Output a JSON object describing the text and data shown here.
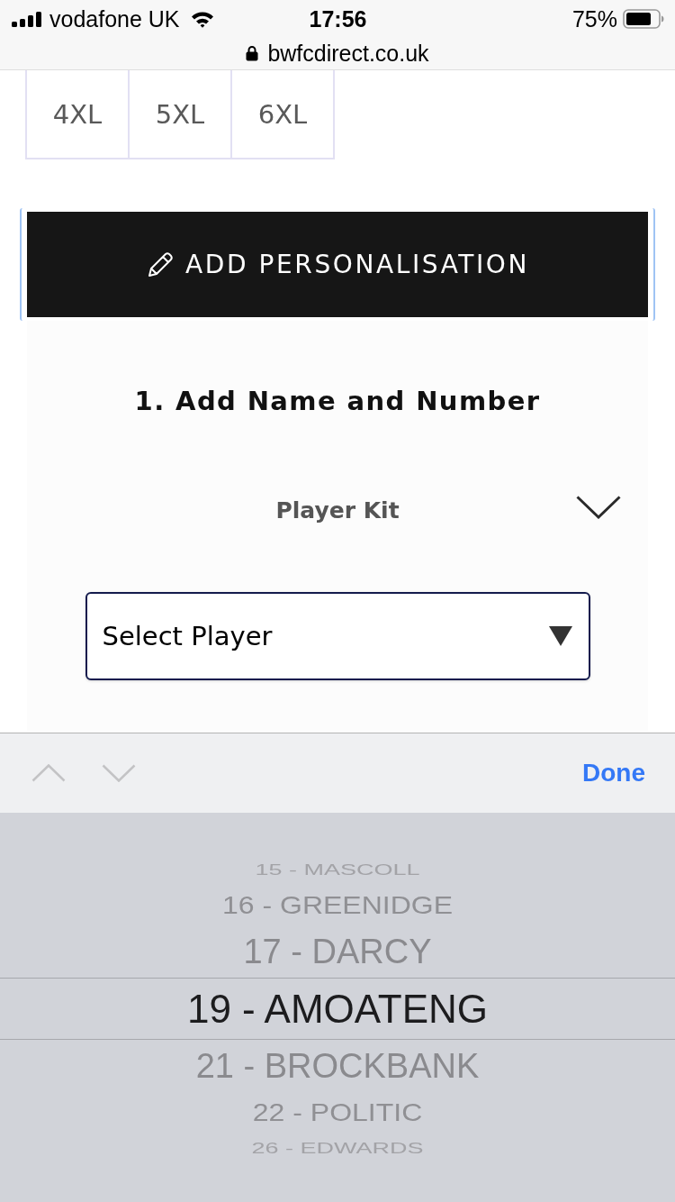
{
  "status_bar": {
    "carrier": "vodafone UK",
    "time": "17:56",
    "battery": "75%"
  },
  "browser": {
    "url": "bwfcdirect.co.uk"
  },
  "sizes": [
    {
      "label": "4XL"
    },
    {
      "label": "5XL"
    },
    {
      "label": "6XL"
    }
  ],
  "personalise_button": {
    "label": "ADD PERSONALISATION",
    "focused": true
  },
  "section": {
    "title": "1. Add Name and Number",
    "kit_label": "Player Kit",
    "player_select": {
      "value": "Select Player"
    }
  },
  "keyboard_bar": {
    "previous": {
      "disabled": true
    },
    "next": {
      "disabled": true
    },
    "done": "Done"
  },
  "picker": {
    "options": [
      {
        "label": "15 - MASCOLL",
        "selected": false
      },
      {
        "label": "16 - GREENIDGE",
        "selected": false
      },
      {
        "label": "17 - DARCY",
        "selected": false
      },
      {
        "label": "19 - AMOATENG",
        "selected": true
      },
      {
        "label": "21 - BROCKBANK",
        "selected": false
      },
      {
        "label": "22 - POLITIC",
        "selected": false
      },
      {
        "label": "26 - EDWARDS",
        "selected": false
      }
    ]
  }
}
